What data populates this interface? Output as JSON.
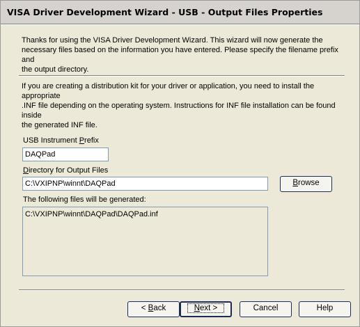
{
  "header": {
    "title": "VISA Driver Development Wizard - USB - Output Files Properties"
  },
  "intro": {
    "paragraph_1": "Thanks for using the VISA Driver Development Wizard.  This wizard will now generate the\nnecessary files based on the information you have entered.  Please specify the filename prefix and\nthe output directory.",
    "paragraph_2": "If you are creating a distribution kit for your driver or application, you need to install the appropriate\n.INF file depending on the operating system.  Instructions for INF file installation can be found inside\nthe generated INF file."
  },
  "form": {
    "prefix_label_before": "USB Instrument ",
    "prefix_label_accel": "P",
    "prefix_label_after": "refix",
    "prefix_value": "DAQPad",
    "directory_label_accel": "D",
    "directory_label_after": "irectory for Output Files",
    "directory_value": "C:\\VXIPNP\\winnt\\DAQPad",
    "browse_label_accel": "B",
    "browse_label_after": "rowse",
    "files_label": "The following files will be generated:",
    "files": [
      "C:\\VXIPNP\\winnt\\DAQPad\\DAQPad.inf"
    ]
  },
  "footer": {
    "back_prefix": "< ",
    "back_accel": "B",
    "back_after": "ack",
    "next_accel": "N",
    "next_after": "ext >",
    "cancel_label": "Cancel",
    "help_label": "Help"
  }
}
